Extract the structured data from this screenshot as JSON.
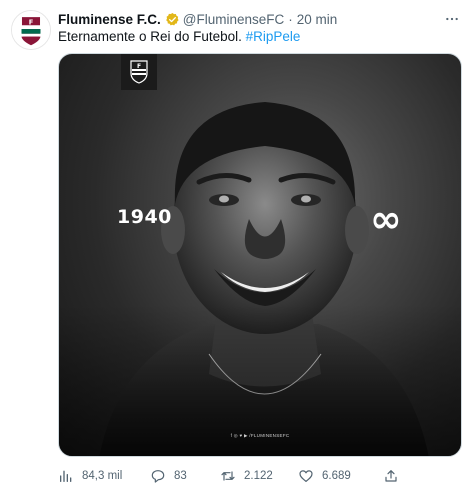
{
  "tweet": {
    "author_name": "Fluminense F.C.",
    "handle": "@FluminenseFC",
    "separator": "·",
    "time": "20 min",
    "text": "Eternamente o Rei do Futebol.",
    "hashtag": "#RipPele",
    "avatar_icon": "fluminense-crest-icon",
    "verified_icon": "gold-verified-badge-icon",
    "colors": {
      "hashtag": "#1d9bf0",
      "verified": "#e2b719",
      "meta_text": "#536471"
    }
  },
  "media": {
    "year_start": "1940",
    "year_end": "∞",
    "footer_tag": "f ◎ ♥ ▶ /FLUMINENSEFC",
    "crest_icon": "fluminense-crest-icon"
  },
  "actions": {
    "views": "84,3 mil",
    "replies": "83",
    "retweets": "2.122",
    "likes": "6.689"
  }
}
